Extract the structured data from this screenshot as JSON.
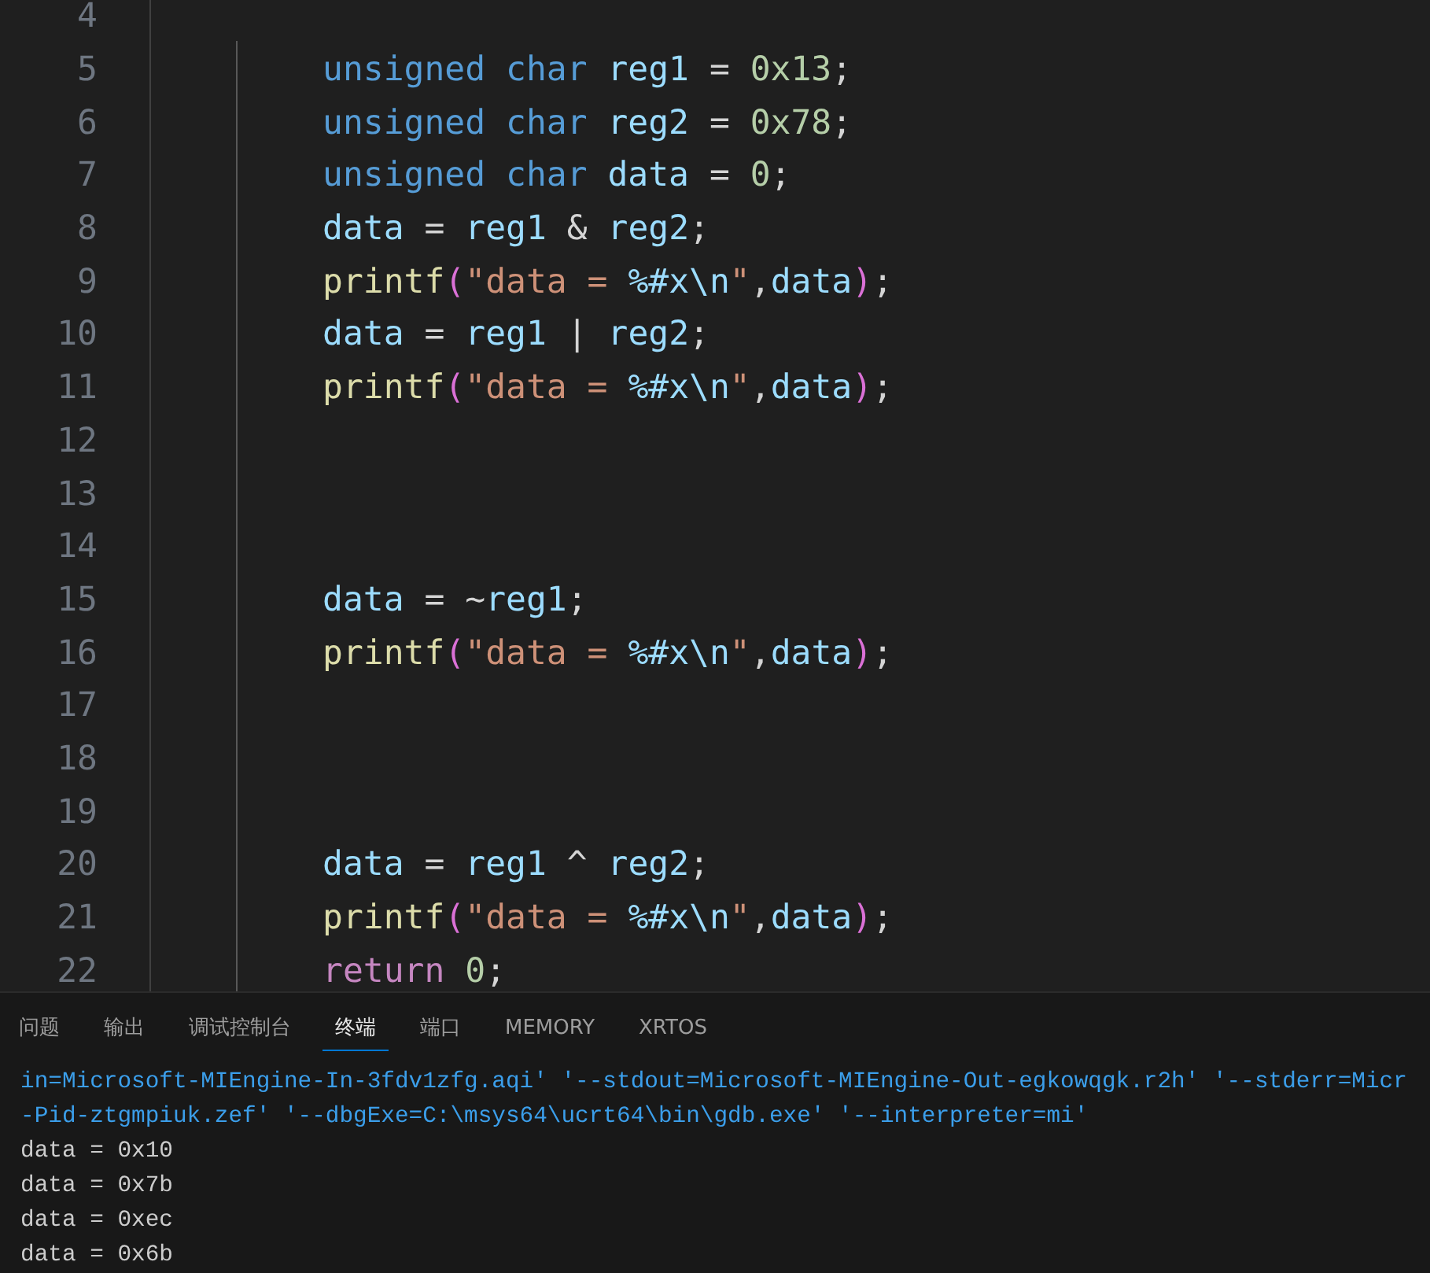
{
  "editor": {
    "lines": [
      {
        "number": "4"
      },
      {
        "number": "5",
        "tokens": [
          {
            "kind": "keyword",
            "text": "unsigned char "
          },
          {
            "kind": "variable",
            "text": "reg1"
          },
          {
            "kind": "plain",
            "text": " = "
          },
          {
            "kind": "number",
            "text": "0x13"
          },
          {
            "kind": "plain",
            "text": ";"
          }
        ]
      },
      {
        "number": "6",
        "tokens": [
          {
            "kind": "keyword",
            "text": "unsigned char "
          },
          {
            "kind": "variable",
            "text": "reg2"
          },
          {
            "kind": "plain",
            "text": " = "
          },
          {
            "kind": "number",
            "text": "0x78"
          },
          {
            "kind": "plain",
            "text": ";"
          }
        ]
      },
      {
        "number": "7",
        "tokens": [
          {
            "kind": "keyword",
            "text": "unsigned char "
          },
          {
            "kind": "variable",
            "text": "data"
          },
          {
            "kind": "plain",
            "text": " = "
          },
          {
            "kind": "number",
            "text": "0"
          },
          {
            "kind": "plain",
            "text": ";"
          }
        ]
      },
      {
        "number": "8",
        "tokens": [
          {
            "kind": "variable",
            "text": "data"
          },
          {
            "kind": "plain",
            "text": " = "
          },
          {
            "kind": "variable",
            "text": "reg1"
          },
          {
            "kind": "plain",
            "text": " & "
          },
          {
            "kind": "variable",
            "text": "reg2"
          },
          {
            "kind": "plain",
            "text": ";"
          }
        ]
      },
      {
        "number": "9",
        "tokens": [
          {
            "kind": "function",
            "text": "printf"
          },
          {
            "kind": "bracket",
            "text": "("
          },
          {
            "kind": "string",
            "text": "\"data = "
          },
          {
            "kind": "escape",
            "text": "%#x\\n"
          },
          {
            "kind": "string",
            "text": "\""
          },
          {
            "kind": "plain",
            "text": ","
          },
          {
            "kind": "variable",
            "text": "data"
          },
          {
            "kind": "bracket",
            "text": ")"
          },
          {
            "kind": "plain",
            "text": ";"
          }
        ]
      },
      {
        "number": "10",
        "tokens": [
          {
            "kind": "variable",
            "text": "data"
          },
          {
            "kind": "plain",
            "text": " = "
          },
          {
            "kind": "variable",
            "text": "reg1"
          },
          {
            "kind": "plain",
            "text": " | "
          },
          {
            "kind": "variable",
            "text": "reg2"
          },
          {
            "kind": "plain",
            "text": ";"
          }
        ]
      },
      {
        "number": "11",
        "tokens": [
          {
            "kind": "function",
            "text": "printf"
          },
          {
            "kind": "bracket",
            "text": "("
          },
          {
            "kind": "string",
            "text": "\"data = "
          },
          {
            "kind": "escape",
            "text": "%#x\\n"
          },
          {
            "kind": "string",
            "text": "\""
          },
          {
            "kind": "plain",
            "text": ","
          },
          {
            "kind": "variable",
            "text": "data"
          },
          {
            "kind": "bracket",
            "text": ")"
          },
          {
            "kind": "plain",
            "text": ";"
          }
        ]
      },
      {
        "number": "12"
      },
      {
        "number": "13"
      },
      {
        "number": "14"
      },
      {
        "number": "15",
        "tokens": [
          {
            "kind": "variable",
            "text": "data"
          },
          {
            "kind": "plain",
            "text": " = ~"
          },
          {
            "kind": "variable",
            "text": "reg1"
          },
          {
            "kind": "plain",
            "text": ";"
          }
        ]
      },
      {
        "number": "16",
        "tokens": [
          {
            "kind": "function",
            "text": "printf"
          },
          {
            "kind": "bracket",
            "text": "("
          },
          {
            "kind": "string",
            "text": "\"data = "
          },
          {
            "kind": "escape",
            "text": "%#x\\n"
          },
          {
            "kind": "string",
            "text": "\""
          },
          {
            "kind": "plain",
            "text": ","
          },
          {
            "kind": "variable",
            "text": "data"
          },
          {
            "kind": "bracket",
            "text": ")"
          },
          {
            "kind": "plain",
            "text": ";"
          }
        ]
      },
      {
        "number": "17"
      },
      {
        "number": "18"
      },
      {
        "number": "19"
      },
      {
        "number": "20",
        "tokens": [
          {
            "kind": "variable",
            "text": "data"
          },
          {
            "kind": "plain",
            "text": " = "
          },
          {
            "kind": "variable",
            "text": "reg1"
          },
          {
            "kind": "plain",
            "text": " ^ "
          },
          {
            "kind": "variable",
            "text": "reg2"
          },
          {
            "kind": "plain",
            "text": ";"
          }
        ]
      },
      {
        "number": "21",
        "tokens": [
          {
            "kind": "function",
            "text": "printf"
          },
          {
            "kind": "bracket",
            "text": "("
          },
          {
            "kind": "string",
            "text": "\"data = "
          },
          {
            "kind": "escape",
            "text": "%#x\\n"
          },
          {
            "kind": "string",
            "text": "\""
          },
          {
            "kind": "plain",
            "text": ","
          },
          {
            "kind": "variable",
            "text": "data"
          },
          {
            "kind": "bracket",
            "text": ")"
          },
          {
            "kind": "plain",
            "text": ";"
          }
        ]
      },
      {
        "number": "22",
        "tokens": [
          {
            "kind": "control",
            "text": "return "
          },
          {
            "kind": "number",
            "text": "0"
          },
          {
            "kind": "plain",
            "text": ";"
          }
        ]
      }
    ]
  },
  "panel": {
    "tabs": [
      {
        "label": "问题",
        "selected": false
      },
      {
        "label": "输出",
        "selected": false
      },
      {
        "label": "调试控制台",
        "selected": false
      },
      {
        "label": "终端",
        "selected": true
      },
      {
        "label": "端口",
        "selected": false
      },
      {
        "label": "MEMORY",
        "selected": false
      },
      {
        "label": "XRTOS",
        "selected": false
      }
    ],
    "terminal": [
      {
        "kind": "command",
        "text": "in=Microsoft-MIEngine-In-3fdv1zfg.aqi' '--stdout=Microsoft-MIEngine-Out-egkowqgk.r2h' '--stderr=Micr"
      },
      {
        "kind": "command",
        "text": "-Pid-ztgmpiuk.zef' '--dbgExe=C:\\msys64\\ucrt64\\bin\\gdb.exe' '--interpreter=mi'"
      },
      {
        "kind": "output",
        "text": "data = 0x10"
      },
      {
        "kind": "output",
        "text": "data = 0x7b"
      },
      {
        "kind": "output",
        "text": "data = 0xec"
      },
      {
        "kind": "output",
        "text": "data = 0x6b"
      }
    ]
  }
}
